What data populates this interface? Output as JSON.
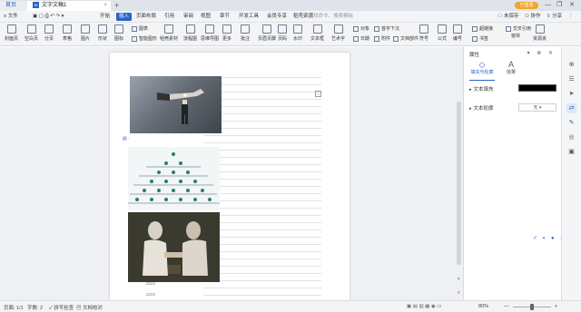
{
  "titlebar": {
    "home_tab": "首页",
    "doc_tab": "文字文稿1",
    "doc_tab_icon": "W",
    "new_tab": "+",
    "login": "已登录",
    "minimize": "—",
    "restore": "❐",
    "close": "✕"
  },
  "menubar": {
    "file": "≡ 文件",
    "items": [
      "开始",
      "插入",
      "页面布局",
      "引用",
      "审阅",
      "视图",
      "章节",
      "开发工具",
      "会员专享",
      "稻壳资源"
    ],
    "search_placeholder": "查找命令、搜索模板",
    "right": [
      "未保存",
      "协作",
      "分享"
    ]
  },
  "ribbon": {
    "big": [
      "封面页",
      "空白页",
      "分页",
      "表格",
      "图片",
      "形状",
      "图标",
      "稻壳素材",
      "流程图",
      "思维导图",
      "更多",
      "批注",
      "页眉页脚",
      "页码",
      "水印",
      "文本框",
      "艺术字",
      "日期",
      "附件",
      "文档部件",
      "符号",
      "公式",
      "编号",
      "超链接",
      "书签",
      "首字下沉",
      "对象",
      "截屏",
      "交叉引用",
      "窗体",
      "资源夹"
    ],
    "small": {
      "chart": "图表",
      "smart": "智能图形",
      "object": "对象",
      "dropcap": "首字下沉",
      "cross": "交叉引用",
      "window": "窗体"
    }
  },
  "document": {
    "page_btn": "□",
    "cursor_icon": "▤ ·",
    "footer_lines": [
      "2222",
      "2222"
    ]
  },
  "panel": {
    "title": "属性",
    "icons": "▾ ⊕ ✕",
    "tabs": [
      {
        "icon": "◇",
        "label": "填充与轮廓"
      },
      {
        "icon": "A",
        "label": "效果"
      }
    ],
    "fill_label": "文本填充",
    "outline_label": "文本轮廓",
    "outline_value": "无",
    "fill_color": "#000000"
  },
  "word_tools": "✓ ◐ ● ↔ ⋯",
  "sidebar_icons": [
    "⊕",
    "☰",
    "➤",
    "⇄",
    "✎",
    "◎",
    "▣"
  ],
  "statusbar": {
    "page": "页面: 1/1",
    "words": "字数: 2",
    "spell": "✓ 拼写检查",
    "proof": "▤ 文档校对",
    "zoom": "80%",
    "zoom_minus": "—",
    "zoom_plus": "+"
  }
}
